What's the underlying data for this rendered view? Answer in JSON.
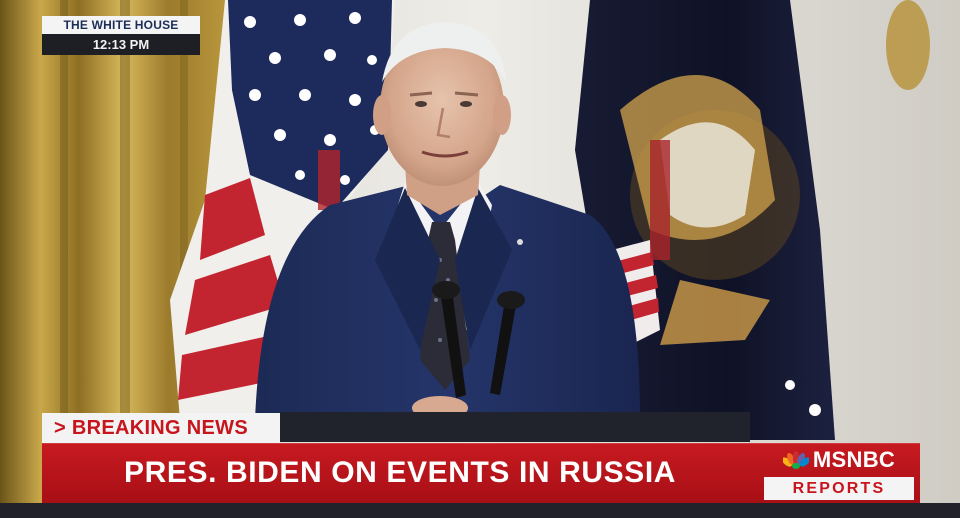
{
  "bug": {
    "location": "THE WHITE HOUSE",
    "time": "12:13 PM"
  },
  "lower_third": {
    "tab_label": "> BREAKING NEWS",
    "headline": "PRES. BIDEN ON EVENTS IN RUSSIA"
  },
  "brand": {
    "network": "MSNBC",
    "program": "REPORTS",
    "logo_icon": "peacock-icon"
  },
  "colors": {
    "news_red": "#c71a20",
    "tab_text_red": "#c8141c",
    "bug_navy": "#1b2e5a"
  }
}
